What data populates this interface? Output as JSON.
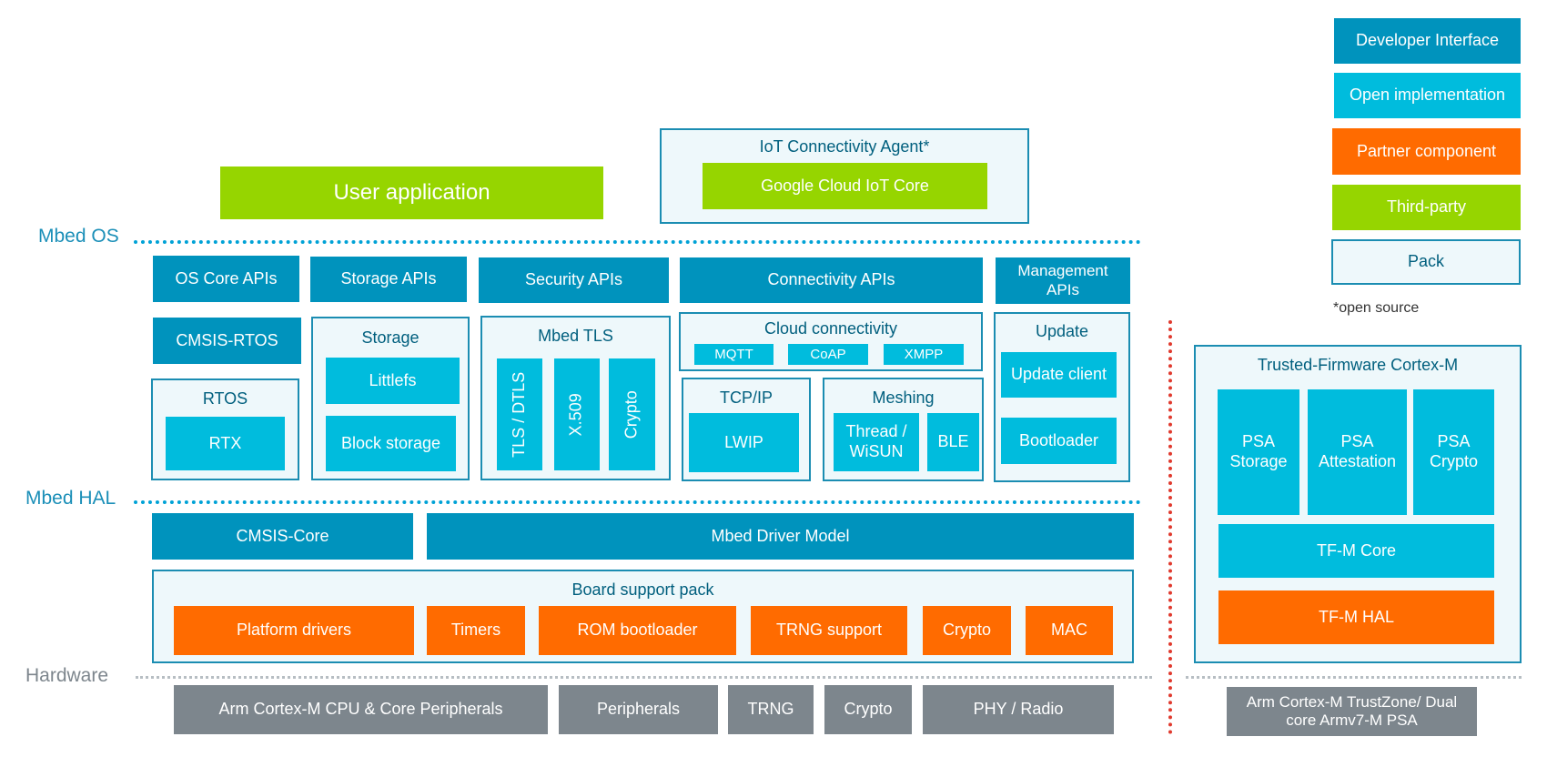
{
  "colors": {
    "developer_interface": "#0093bd",
    "open_implementation": "#00bcdd",
    "partner_component": "#ff6b00",
    "third_party": "#96d500",
    "pack_background": "#eef8fb",
    "pack_border": "#1b8db2",
    "hardware": "#7d868d",
    "boundary_line": "#e03a2e"
  },
  "legend": {
    "items": [
      {
        "label": "Developer Interface",
        "kind": "developer_interface"
      },
      {
        "label": "Open implementation",
        "kind": "open_implementation"
      },
      {
        "label": "Partner component",
        "kind": "partner_component"
      },
      {
        "label": "Third-party",
        "kind": "third_party"
      },
      {
        "label": "Pack",
        "kind": "pack"
      }
    ],
    "note": "*open source"
  },
  "layers": {
    "mbed_os": "Mbed OS",
    "mbed_hal": "Mbed HAL",
    "hardware": "Hardware"
  },
  "top": {
    "user_application": "User application",
    "iot_agent": {
      "title": "IoT Connectivity Agent*",
      "google": "Google Cloud IoT Core"
    }
  },
  "os": {
    "os_core_apis": "OS Core APIs",
    "cmsis_rtos": "CMSIS-RTOS",
    "rtos": {
      "title": "RTOS",
      "rtx": "RTX"
    },
    "storage_apis": "Storage APIs",
    "storage": {
      "title": "Storage",
      "littlefs": "Littlefs",
      "block_storage": "Block storage"
    },
    "security_apis": "Security APIs",
    "mbed_tls": {
      "title": "Mbed TLS",
      "items": [
        "TLS / DTLS",
        "X.509",
        "Crypto"
      ]
    },
    "connectivity_apis": "Connectivity APIs",
    "cloud_connectivity": {
      "title": "Cloud connectivity",
      "items": [
        "MQTT",
        "CoAP",
        "XMPP"
      ]
    },
    "tcpip": {
      "title": "TCP/IP",
      "lwip": "LWIP"
    },
    "meshing": {
      "title": "Meshing",
      "thread": "Thread / WiSUN",
      "ble": "BLE"
    },
    "management_apis": "Management APIs",
    "update": {
      "title": "Update",
      "client": "Update client",
      "bootloader": "Bootloader"
    }
  },
  "hal": {
    "cmsis_core": "CMSIS-Core",
    "driver_model": "Mbed Driver Model",
    "bsp": {
      "title": "Board support pack",
      "items": [
        "Platform drivers",
        "Timers",
        "ROM bootloader",
        "TRNG support",
        "Crypto",
        "MAC"
      ]
    }
  },
  "tfm": {
    "title": "Trusted-Firmware Cortex-M",
    "psa": [
      "PSA Storage",
      "PSA Attestation",
      "PSA Crypto"
    ],
    "core": "TF-M Core",
    "hal": "TF-M HAL"
  },
  "hardware": {
    "items": [
      "Arm Cortex-M CPU & Core Peripherals",
      "Peripherals",
      "TRNG",
      "Crypto",
      "PHY / Radio"
    ],
    "secure": "Arm Cortex-M TrustZone/ Dual core Armv7-M PSA"
  }
}
